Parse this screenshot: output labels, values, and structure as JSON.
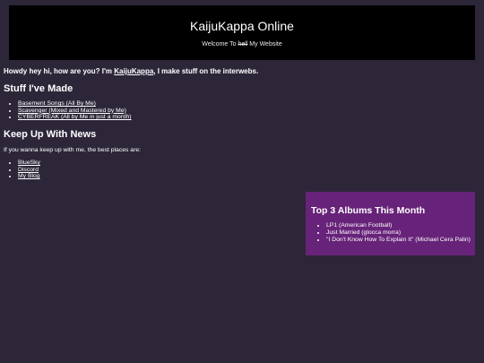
{
  "header": {
    "title": "KaijuKappa Online",
    "subtitle_before": "Welcome To ",
    "subtitle_struck": "hell",
    "subtitle_after": " My Website"
  },
  "intro": {
    "before": "Howdy hey hi, how are you? I'm ",
    "name_link": "KaijuKappa",
    "after": ", I make stuff on the interwebs."
  },
  "stuff_section": {
    "heading": "Stuff I've Made",
    "items": [
      "Basement Songs (All By Me)",
      "Scavenger (Mixed and Mastered by Me)",
      "CYBERFREAK (All by Me in just a month)"
    ]
  },
  "news_section": {
    "heading": "Keep Up With News",
    "text": "If you wanna keep up with me, the best places are:",
    "links": [
      "BlueSky",
      "Discord",
      "My Blog"
    ]
  },
  "albums_section": {
    "heading": "Top 3 Albums This Month",
    "items": [
      "LP1 (American Football)",
      "Just Married (glocca morra)",
      "\"I Don't Know How To Explain It\" (Michael Cera Palin)"
    ]
  },
  "colors": {
    "page_background": "#2d2639",
    "header_background": "#000000",
    "albums_background": "#672379",
    "text": "#ffffff"
  }
}
